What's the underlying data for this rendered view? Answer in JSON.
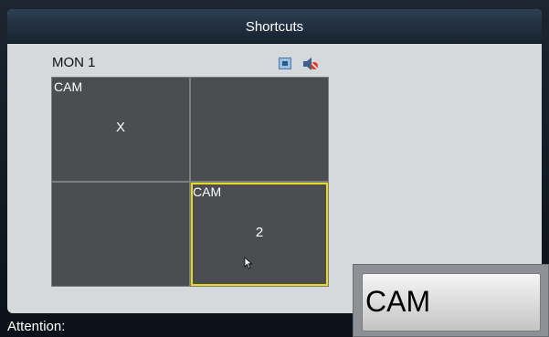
{
  "dialog": {
    "title": "Shortcuts"
  },
  "monitor": {
    "label": "MON 1"
  },
  "icons": {
    "fullscreen": "fullscreen-icon",
    "mute": "mute-icon"
  },
  "grid": {
    "cells": [
      {
        "label": "CAM",
        "number": "X",
        "selected": false
      },
      {
        "label": "",
        "number": "",
        "selected": false
      },
      {
        "label": "",
        "number": "",
        "selected": false
      },
      {
        "label": "CAM",
        "number": "2",
        "selected": true
      }
    ]
  },
  "status": {
    "attention_label": "Attention:"
  },
  "popup_menu": {
    "item_label": "CAM"
  },
  "colors": {
    "selection": "#e3db1c",
    "cell_background": "#4b4d50",
    "mute_icon": "#d93c2b"
  }
}
